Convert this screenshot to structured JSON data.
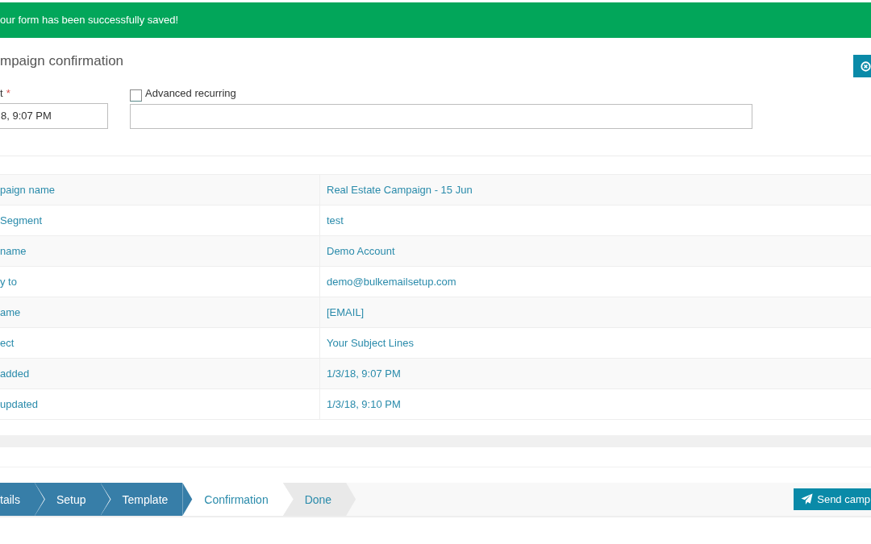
{
  "alert": {
    "message": "our form has been successfully saved!"
  },
  "header": {
    "title": "mpaign confirmation"
  },
  "form": {
    "date_field": {
      "label": "t",
      "required_mark": "*",
      "value": "8, 9:07 PM"
    },
    "advanced_recurring": {
      "label": "Advanced recurring",
      "checked": false
    }
  },
  "details": {
    "rows": [
      {
        "label": "paign name",
        "value": "Real Estate Campaign - 15 Jun"
      },
      {
        "label": "Segment",
        "value": "test"
      },
      {
        "label": "name",
        "value": "Demo Account"
      },
      {
        "label": "y to",
        "value": "demo@bulkemailsetup.com"
      },
      {
        "label": "ame",
        "value": "[EMAIL]"
      },
      {
        "label": "ect",
        "value": "Your Subject Lines"
      },
      {
        "label": "added",
        "value": "1/3/18, 9:07 PM"
      },
      {
        "label": "updated",
        "value": "1/3/18, 9:10 PM"
      }
    ]
  },
  "wizard": {
    "steps": [
      {
        "label": "tails",
        "completed": true,
        "selected": false
      },
      {
        "label": "Setup",
        "completed": true,
        "selected": false
      },
      {
        "label": "Template",
        "completed": true,
        "selected": false
      },
      {
        "label": "Confirmation",
        "completed": false,
        "selected": true
      },
      {
        "label": "Done",
        "completed": false,
        "selected": false
      }
    ],
    "send_button": {
      "label": "Send camp"
    }
  }
}
